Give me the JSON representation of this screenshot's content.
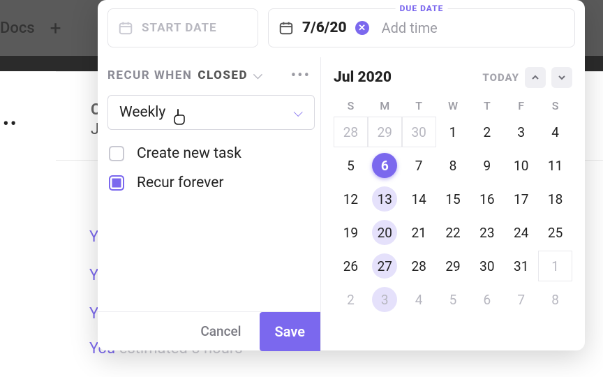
{
  "background": {
    "docs_label": "Docs",
    "cr_text": "CR",
    "ju_text": "Ju",
    "links": [
      "Yo",
      "Yo",
      "Yo"
    ],
    "row_estimate_prefix": "You",
    "row_estimate_rest": " estimated 8 hours"
  },
  "modal": {
    "start": {
      "placeholder": "START DATE"
    },
    "due": {
      "label": "DUE DATE",
      "date": "7/6/20",
      "add_time": "Add time"
    },
    "recur": {
      "label": "RECUR WHEN",
      "state": "CLOSED",
      "frequency": "Weekly",
      "options": [
        {
          "label": "Create new task",
          "checked": false
        },
        {
          "label": "Recur forever",
          "checked": true
        }
      ]
    },
    "footer": {
      "cancel": "Cancel",
      "save": "Save"
    },
    "calendar": {
      "title": "Jul 2020",
      "today": "TODAY",
      "dow": [
        "S",
        "M",
        "T",
        "W",
        "T",
        "F",
        "S"
      ],
      "cells": [
        {
          "n": "28",
          "cls": "outside box"
        },
        {
          "n": "29",
          "cls": "outside box"
        },
        {
          "n": "30",
          "cls": "outside box"
        },
        {
          "n": "1",
          "cls": ""
        },
        {
          "n": "2",
          "cls": ""
        },
        {
          "n": "3",
          "cls": ""
        },
        {
          "n": "4",
          "cls": ""
        },
        {
          "n": "5",
          "cls": ""
        },
        {
          "n": "6",
          "cls": "sel"
        },
        {
          "n": "7",
          "cls": ""
        },
        {
          "n": "8",
          "cls": ""
        },
        {
          "n": "9",
          "cls": ""
        },
        {
          "n": "10",
          "cls": ""
        },
        {
          "n": "11",
          "cls": ""
        },
        {
          "n": "12",
          "cls": ""
        },
        {
          "n": "13",
          "cls": "hl"
        },
        {
          "n": "14",
          "cls": ""
        },
        {
          "n": "15",
          "cls": ""
        },
        {
          "n": "16",
          "cls": ""
        },
        {
          "n": "17",
          "cls": ""
        },
        {
          "n": "18",
          "cls": ""
        },
        {
          "n": "19",
          "cls": ""
        },
        {
          "n": "20",
          "cls": "hl"
        },
        {
          "n": "21",
          "cls": ""
        },
        {
          "n": "22",
          "cls": ""
        },
        {
          "n": "23",
          "cls": ""
        },
        {
          "n": "24",
          "cls": ""
        },
        {
          "n": "25",
          "cls": ""
        },
        {
          "n": "26",
          "cls": ""
        },
        {
          "n": "27",
          "cls": "hl"
        },
        {
          "n": "28",
          "cls": ""
        },
        {
          "n": "29",
          "cls": ""
        },
        {
          "n": "30",
          "cls": ""
        },
        {
          "n": "31",
          "cls": ""
        },
        {
          "n": "1",
          "cls": "outside box"
        },
        {
          "n": "2",
          "cls": "outside"
        },
        {
          "n": "3",
          "cls": "outside hl"
        },
        {
          "n": "4",
          "cls": "outside"
        },
        {
          "n": "5",
          "cls": "outside"
        },
        {
          "n": "6",
          "cls": "outside"
        },
        {
          "n": "7",
          "cls": "outside"
        },
        {
          "n": "8",
          "cls": "outside"
        }
      ]
    }
  }
}
